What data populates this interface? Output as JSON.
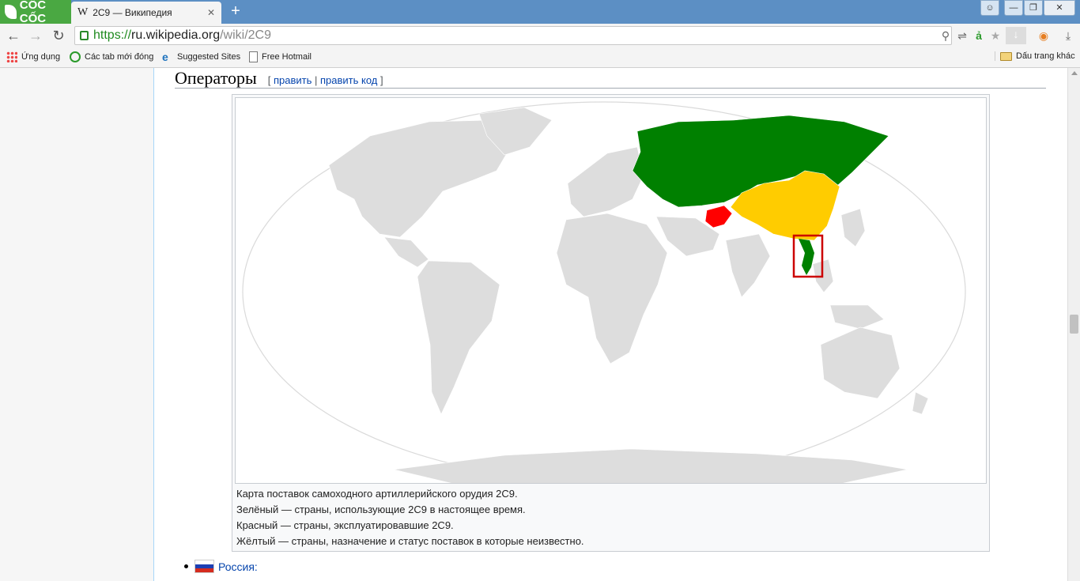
{
  "browser": {
    "brand": "CỐC CỐC",
    "tab": {
      "favicon": "W",
      "title": "2C9 — Википедия",
      "close": "✕"
    },
    "new_tab": "+",
    "url": {
      "scheme": "https://",
      "host": "ru.wikipedia.org",
      "path": "/wiki/2C9"
    },
    "bookmarks": [
      {
        "label": "Ứng dụng",
        "icon": "apps-grid-icon"
      },
      {
        "label": "Các tab mới đóng",
        "icon": "recent-tabs-icon"
      },
      {
        "label": "Suggested Sites",
        "icon": "ie-icon"
      },
      {
        "label": "Free Hotmail",
        "icon": "page-icon"
      }
    ],
    "other_bookmarks": "Dấu trang khác"
  },
  "article": {
    "section_title": "Операторы",
    "edit_open": "[ ",
    "edit": "править",
    "edit_sep": " | ",
    "edit_code": "править код",
    "edit_close": " ]",
    "map": {
      "colors": {
        "operator": "#008000",
        "former": "#ff0000",
        "unknown": "#ffcc00",
        "land": "#dddddd",
        "highlight": "#cc0000"
      }
    },
    "caption": [
      "Карта поставок самоходного артиллерийского орудия 2С9.",
      "Зелёный — страны, использующие 2С9 в настоящее время.",
      "Красный — страны, эксплуатировавшие 2С9.",
      "Жёлтый — страны, назначение и статус поставок в которые неизвестно."
    ],
    "list": [
      {
        "label": "Россия:"
      }
    ]
  }
}
